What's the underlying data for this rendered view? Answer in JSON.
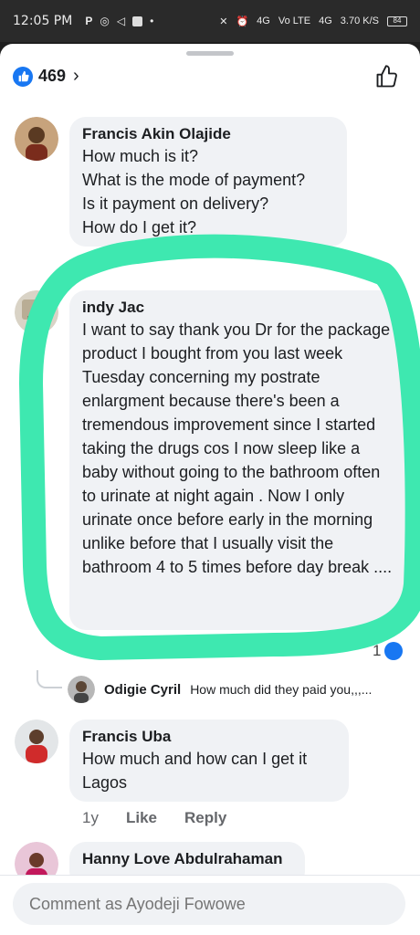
{
  "status": {
    "time": "12:05 PM",
    "icons": [
      "P",
      "whatsapp-icon",
      "telegram-icon",
      "square-icon",
      "•"
    ],
    "network": [
      "4G",
      "Vo LTE",
      "4G"
    ],
    "speed": "3.70 K/S",
    "battery": "84"
  },
  "reactions": {
    "count": "469"
  },
  "comments": [
    {
      "author": "Francis Akin Olajide",
      "text": "How much is it?\nWhat is the mode of payment?\nIs it payment on delivery?\nHow do I get it?"
    },
    {
      "author": "indy Jac",
      "text": "I want to say thank you Dr for the package product I bought from you last week Tuesday concerning my postrate enlargment because there's been a tremendous improvement since I started taking the drugs cos I now sleep like a baby without going to the bathroom often to urinate at night again . Now I only urinate once before early in the morning unlike before that I usually visit the bathroom 4 to 5 times before day break ....",
      "reply_count": "1"
    },
    {
      "author": "Francis Uba",
      "text": "How much and how can I get it\nLagos",
      "meta": {
        "time": "1y",
        "like": "Like",
        "reply": "Reply"
      }
    },
    {
      "author": "Hanny Love Abdulrahaman"
    }
  ],
  "reply": {
    "author": "Odigie Cyril",
    "text": "How much did they paid you,,,..."
  },
  "composer": {
    "placeholder": "Comment as Ayodeji Fowowe"
  },
  "colors": {
    "accent": "#1877f2",
    "highlight": "#3ee8b0",
    "bubble": "#f0f2f5"
  }
}
